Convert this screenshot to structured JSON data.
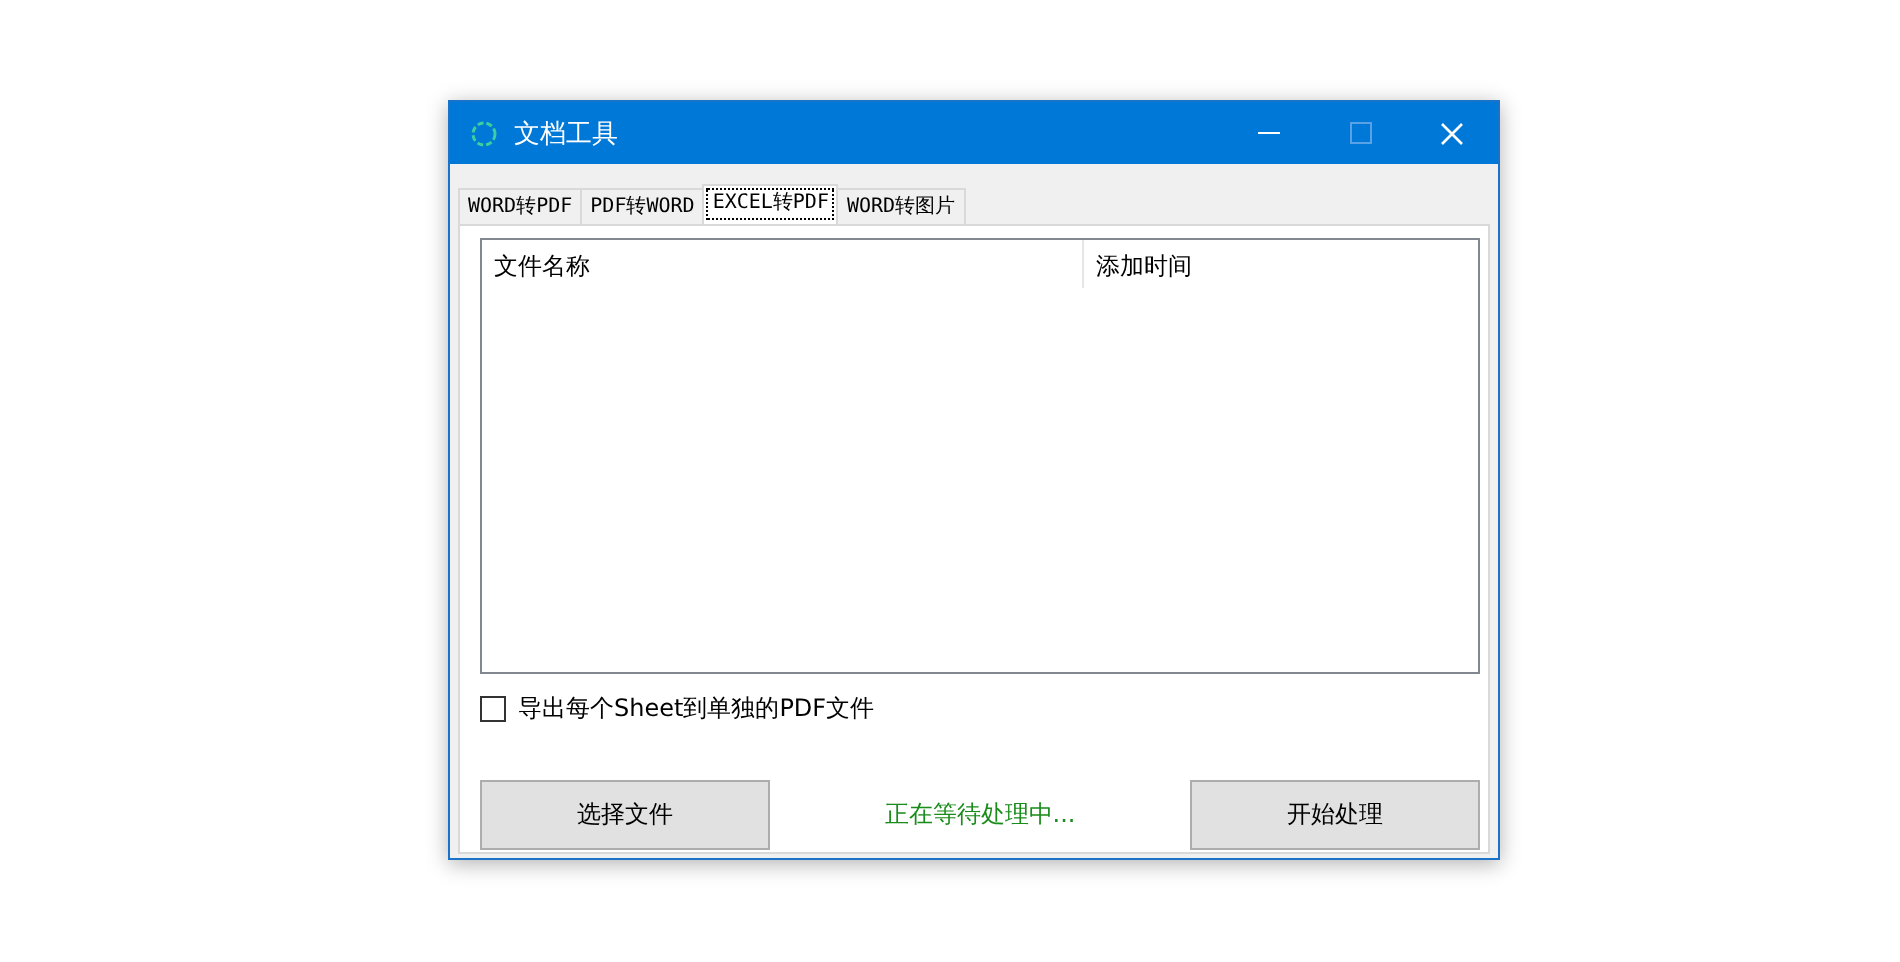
{
  "window": {
    "title": "文档工具"
  },
  "tabs": [
    {
      "label": "WORD转PDF",
      "selected": false
    },
    {
      "label": "PDF转WORD",
      "selected": false
    },
    {
      "label": "EXCEL转PDF",
      "selected": true
    },
    {
      "label": "WORD转图片",
      "selected": false
    }
  ],
  "table": {
    "columns": [
      "文件名称",
      "添加时间"
    ]
  },
  "option": {
    "label": "导出每个Sheet到单独的PDF文件",
    "checked": false
  },
  "buttons": [
    "选择文件",
    "开始处理"
  ],
  "status": "正在等待处理中..."
}
